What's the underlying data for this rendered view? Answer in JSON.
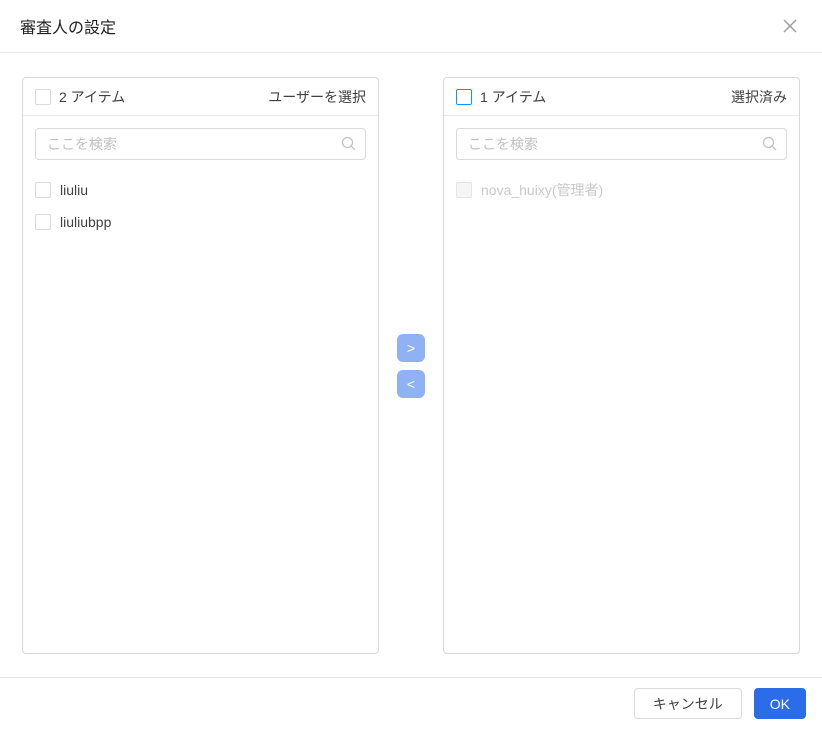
{
  "dialog": {
    "title": "審査人の設定"
  },
  "transfer": {
    "left_panel": {
      "count": "2 アイテム",
      "title": "ユーザーを選択",
      "search_placeholder": "ここを検索",
      "items": [
        {
          "label": "liuliu",
          "disabled": false,
          "checked": false
        },
        {
          "label": "liuliubpp",
          "disabled": false,
          "checked": false
        }
      ]
    },
    "right_panel": {
      "count": "1 アイテム",
      "title": "選択済み",
      "search_placeholder": "ここを検索",
      "items": [
        {
          "label": "nova_huixy(管理者)",
          "disabled": true,
          "checked": false
        }
      ]
    },
    "move_right_label": ">",
    "move_left_label": "<"
  },
  "footer": {
    "cancel_label": "キャンセル",
    "ok_label": "OK"
  },
  "colors": {
    "primary_button": "#2b6de8",
    "arrow_button": "#8fb2f5",
    "active_checkbox_border": "#1890ff",
    "panel_border": "#d9d9d9",
    "disabled_text": "#c9c9c9"
  }
}
